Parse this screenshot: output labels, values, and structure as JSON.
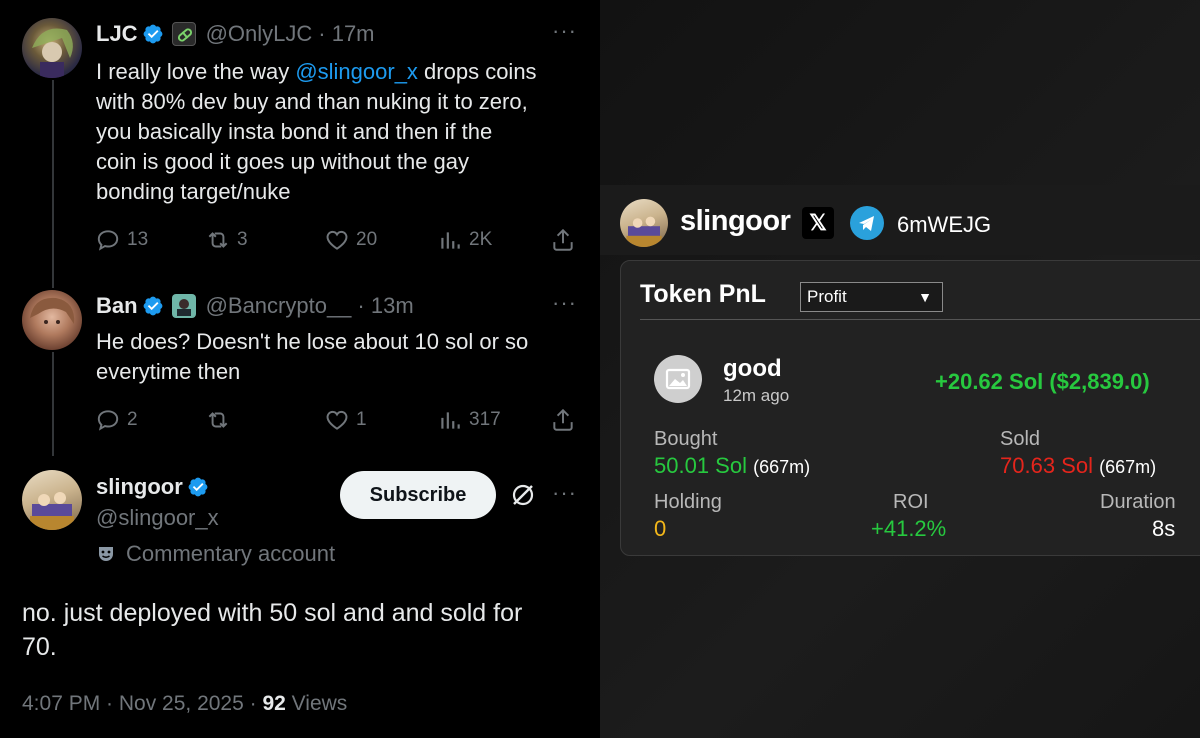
{
  "tweet1": {
    "name": "LJC",
    "handle": "@OnlyLJC",
    "time": "· 17m",
    "text_before": "I really love the way ",
    "mention": "@slingoor_x",
    "text_line1_after": " drops coins",
    "text_line2": "with 80% dev buy and than nuking it to zero,",
    "text_line3": "you basically insta bond it and then if the",
    "text_line4": "coin is good it goes up without the gay",
    "text_line5": "bonding target/nuke",
    "replies": "13",
    "reposts": "3",
    "likes": "20",
    "views": "2K"
  },
  "tweet2": {
    "name": "Ban",
    "handle": "@Bancrypto__",
    "time": "· 13m",
    "text_line1": "He does? Doesn't he lose about 10 sol or so",
    "text_line2": "everytime then",
    "replies": "2",
    "reposts": "",
    "likes": "1",
    "views": "317"
  },
  "tweet3": {
    "name": "slingoor",
    "handle": "@slingoor_x",
    "subscribe_label": "Subscribe",
    "account_label": "Commentary account",
    "text_line1": "no. just deployed with 50 sol and and sold for",
    "text_line2": "70.",
    "timestamp": "4:07 PM · Nov 25, 2025 · ",
    "views_count": "92",
    "views_label": " Views"
  },
  "pnl": {
    "user": "slingoor",
    "x_label": "𝕏",
    "wallet": "6mWEJG",
    "title": "Token PnL",
    "filter": "Profit",
    "token_name": "good",
    "token_time": "12m ago",
    "profit": "+20.62 Sol ($2,839.0)",
    "bought_label": "Bought",
    "bought_value": "50.01 Sol",
    "bought_sub": "(667m)",
    "sold_label": "Sold",
    "sold_value": "70.63 Sol",
    "sold_sub": "(667m)",
    "holding_label": "Holding",
    "holding_value": "0",
    "roi_label": "ROI",
    "roi_value": "+41.2%",
    "duration_label": "Duration",
    "duration_value": "8s"
  },
  "colors": {
    "link": "#1d9bf0",
    "verified": "#1d9bf0",
    "profit_green": "#27c93f",
    "loss_red": "#e5251c",
    "holding_yellow": "#f3b71a"
  }
}
